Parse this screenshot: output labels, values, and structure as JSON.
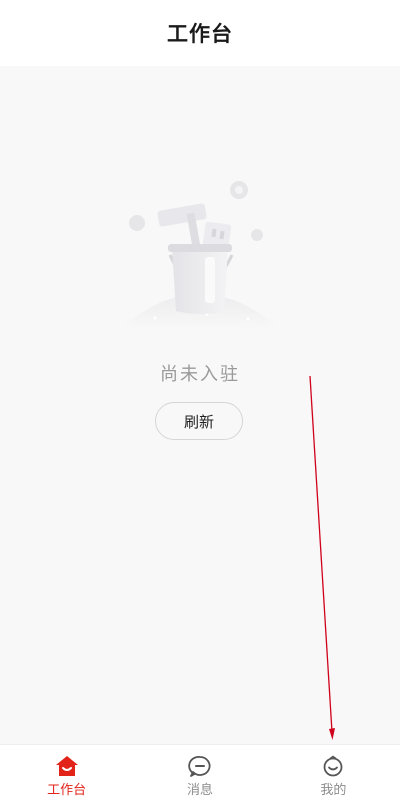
{
  "header": {
    "title": "工作台"
  },
  "empty_state": {
    "message": "尚未入驻",
    "illustration_icon": "empty-bucket-illustration",
    "refresh_label": "刷新"
  },
  "tabbar": {
    "active_color": "#e2231a",
    "inactive_color": "#8c8c8c",
    "tabs": [
      {
        "label": "工作台",
        "icon": "home-icon",
        "active": true
      },
      {
        "label": "消息",
        "icon": "message-icon",
        "active": false
      },
      {
        "label": "我的",
        "icon": "profile-icon",
        "active": false
      }
    ]
  },
  "annotation": {
    "color": "#d0021b",
    "type": "arrow"
  }
}
